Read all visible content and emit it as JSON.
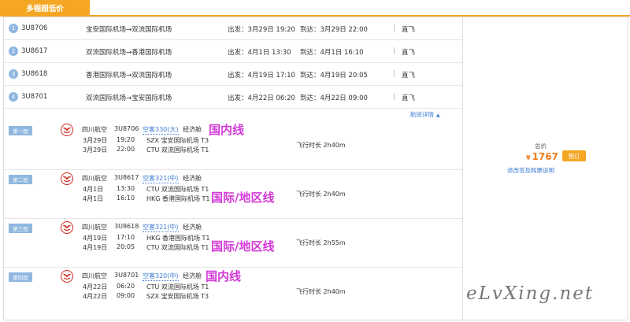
{
  "tab_title": "多程超低价",
  "flights": [
    {
      "num": "1",
      "code": "3U8706",
      "route": "宝安国际机场→双流国际机场",
      "dep": "出发：3月29日 19:20",
      "arr": "到达：3月29日 22:00",
      "type": "直飞"
    },
    {
      "num": "2",
      "code": "3U8617",
      "route": "双流国际机场→香港国际机场",
      "dep": "出发：4月1日 13:30",
      "arr": "到达：4月1日 16:10",
      "type": "直飞"
    },
    {
      "num": "3",
      "code": "3U8618",
      "route": "香港国际机场→双流国际机场",
      "dep": "出发：4月19日 17:10",
      "arr": "到达：4月19日 20:05",
      "type": "直飞"
    },
    {
      "num": "4",
      "code": "3U8701",
      "route": "双流国际机场→宝安国际机场",
      "dep": "出发：4月22日 06:20",
      "arr": "到达：4月22日 09:00",
      "type": "直飞"
    }
  ],
  "detail_link": "航班详情",
  "segments": [
    {
      "badge": "第一程",
      "airline": "四川航空",
      "flight": "3U8706",
      "plane": "空客330(大)",
      "cabin": "经济舱",
      "dep_date": "3月29日",
      "dep_time": "19:20",
      "dep_airport": "SZX 宝安国际机场 T3",
      "arr_date": "3月29日",
      "arr_time": "22:00",
      "arr_airport": "CTU 双流国际机场 T1",
      "duration": "飞行时长 2h40m",
      "tag": "国内线"
    },
    {
      "badge": "第二程",
      "airline": "四川航空",
      "flight": "3U8617",
      "plane": "空客321(中)",
      "cabin": "经济舱",
      "dep_date": "4月1日",
      "dep_time": "13:30",
      "dep_airport": "CTU 双流国际机场 T1",
      "arr_date": "4月1日",
      "arr_time": "16:10",
      "arr_airport": "HKG 香港国际机场 T1",
      "duration": "飞行时长 2h40m",
      "tag": "国际/地区线"
    },
    {
      "badge": "第三程",
      "airline": "四川航空",
      "flight": "3U8618",
      "plane": "空客321(中)",
      "cabin": "经济舱",
      "dep_date": "4月19日",
      "dep_time": "17:10",
      "dep_airport": "HKG 香港国际机场 T1",
      "arr_date": "4月19日",
      "arr_time": "20:05",
      "arr_airport": "CTU 双流国际机场 T1",
      "duration": "飞行时长 2h55m",
      "tag": "国际/地区线"
    },
    {
      "badge": "第四程",
      "airline": "四川航空",
      "flight": "3U8701",
      "plane": "空客320(中)",
      "cabin": "经济舱",
      "dep_date": "4月22日",
      "dep_time": "06:20",
      "dep_airport": "CTU 双流国际机场 T1",
      "arr_date": "4月22日",
      "arr_time": "09:00",
      "arr_airport": "SZX 宝安国际机场 T3",
      "duration": "飞行时长 2h40m",
      "tag": "国内线"
    }
  ],
  "summary": {
    "total_label": "总价",
    "currency": "¥",
    "price": "1767",
    "book_label": "预订",
    "rules_link": "退改签及购票说明"
  },
  "watermark": "eLvXing.net",
  "colors": {
    "accent": "#f5a623",
    "badge": "#8fb7e0",
    "link": "#3a7bd5",
    "price": "#f07d1a",
    "tag": "#d23bd6"
  },
  "icons": {
    "airline_logo": "sichuan-airlines-logo-icon",
    "caret": "caret-up-icon"
  }
}
